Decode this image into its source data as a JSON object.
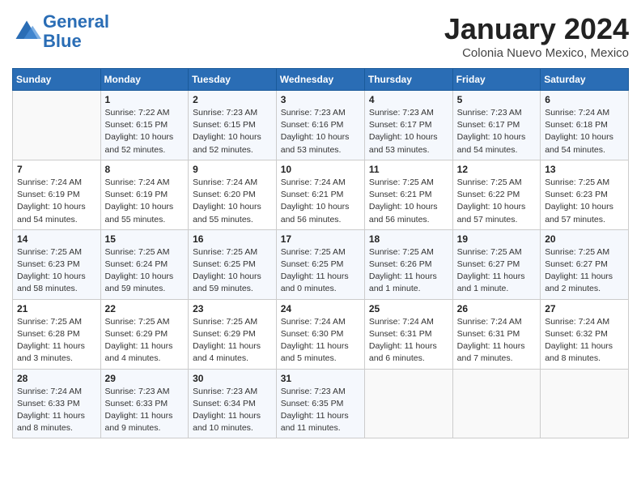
{
  "header": {
    "logo_line1": "General",
    "logo_line2": "Blue",
    "month_title": "January 2024",
    "subtitle": "Colonia Nuevo Mexico, Mexico"
  },
  "days_of_week": [
    "Sunday",
    "Monday",
    "Tuesday",
    "Wednesday",
    "Thursday",
    "Friday",
    "Saturday"
  ],
  "weeks": [
    [
      {
        "day": "",
        "sunrise": "",
        "sunset": "",
        "daylight": ""
      },
      {
        "day": "1",
        "sunrise": "Sunrise: 7:22 AM",
        "sunset": "Sunset: 6:15 PM",
        "daylight": "Daylight: 10 hours and 52 minutes."
      },
      {
        "day": "2",
        "sunrise": "Sunrise: 7:23 AM",
        "sunset": "Sunset: 6:15 PM",
        "daylight": "Daylight: 10 hours and 52 minutes."
      },
      {
        "day": "3",
        "sunrise": "Sunrise: 7:23 AM",
        "sunset": "Sunset: 6:16 PM",
        "daylight": "Daylight: 10 hours and 53 minutes."
      },
      {
        "day": "4",
        "sunrise": "Sunrise: 7:23 AM",
        "sunset": "Sunset: 6:17 PM",
        "daylight": "Daylight: 10 hours and 53 minutes."
      },
      {
        "day": "5",
        "sunrise": "Sunrise: 7:23 AM",
        "sunset": "Sunset: 6:17 PM",
        "daylight": "Daylight: 10 hours and 54 minutes."
      },
      {
        "day": "6",
        "sunrise": "Sunrise: 7:24 AM",
        "sunset": "Sunset: 6:18 PM",
        "daylight": "Daylight: 10 hours and 54 minutes."
      }
    ],
    [
      {
        "day": "7",
        "sunrise": "Sunrise: 7:24 AM",
        "sunset": "Sunset: 6:19 PM",
        "daylight": "Daylight: 10 hours and 54 minutes."
      },
      {
        "day": "8",
        "sunrise": "Sunrise: 7:24 AM",
        "sunset": "Sunset: 6:19 PM",
        "daylight": "Daylight: 10 hours and 55 minutes."
      },
      {
        "day": "9",
        "sunrise": "Sunrise: 7:24 AM",
        "sunset": "Sunset: 6:20 PM",
        "daylight": "Daylight: 10 hours and 55 minutes."
      },
      {
        "day": "10",
        "sunrise": "Sunrise: 7:24 AM",
        "sunset": "Sunset: 6:21 PM",
        "daylight": "Daylight: 10 hours and 56 minutes."
      },
      {
        "day": "11",
        "sunrise": "Sunrise: 7:25 AM",
        "sunset": "Sunset: 6:21 PM",
        "daylight": "Daylight: 10 hours and 56 minutes."
      },
      {
        "day": "12",
        "sunrise": "Sunrise: 7:25 AM",
        "sunset": "Sunset: 6:22 PM",
        "daylight": "Daylight: 10 hours and 57 minutes."
      },
      {
        "day": "13",
        "sunrise": "Sunrise: 7:25 AM",
        "sunset": "Sunset: 6:23 PM",
        "daylight": "Daylight: 10 hours and 57 minutes."
      }
    ],
    [
      {
        "day": "14",
        "sunrise": "Sunrise: 7:25 AM",
        "sunset": "Sunset: 6:23 PM",
        "daylight": "Daylight: 10 hours and 58 minutes."
      },
      {
        "day": "15",
        "sunrise": "Sunrise: 7:25 AM",
        "sunset": "Sunset: 6:24 PM",
        "daylight": "Daylight: 10 hours and 59 minutes."
      },
      {
        "day": "16",
        "sunrise": "Sunrise: 7:25 AM",
        "sunset": "Sunset: 6:25 PM",
        "daylight": "Daylight: 10 hours and 59 minutes."
      },
      {
        "day": "17",
        "sunrise": "Sunrise: 7:25 AM",
        "sunset": "Sunset: 6:25 PM",
        "daylight": "Daylight: 11 hours and 0 minutes."
      },
      {
        "day": "18",
        "sunrise": "Sunrise: 7:25 AM",
        "sunset": "Sunset: 6:26 PM",
        "daylight": "Daylight: 11 hours and 1 minute."
      },
      {
        "day": "19",
        "sunrise": "Sunrise: 7:25 AM",
        "sunset": "Sunset: 6:27 PM",
        "daylight": "Daylight: 11 hours and 1 minute."
      },
      {
        "day": "20",
        "sunrise": "Sunrise: 7:25 AM",
        "sunset": "Sunset: 6:27 PM",
        "daylight": "Daylight: 11 hours and 2 minutes."
      }
    ],
    [
      {
        "day": "21",
        "sunrise": "Sunrise: 7:25 AM",
        "sunset": "Sunset: 6:28 PM",
        "daylight": "Daylight: 11 hours and 3 minutes."
      },
      {
        "day": "22",
        "sunrise": "Sunrise: 7:25 AM",
        "sunset": "Sunset: 6:29 PM",
        "daylight": "Daylight: 11 hours and 4 minutes."
      },
      {
        "day": "23",
        "sunrise": "Sunrise: 7:25 AM",
        "sunset": "Sunset: 6:29 PM",
        "daylight": "Daylight: 11 hours and 4 minutes."
      },
      {
        "day": "24",
        "sunrise": "Sunrise: 7:24 AM",
        "sunset": "Sunset: 6:30 PM",
        "daylight": "Daylight: 11 hours and 5 minutes."
      },
      {
        "day": "25",
        "sunrise": "Sunrise: 7:24 AM",
        "sunset": "Sunset: 6:31 PM",
        "daylight": "Daylight: 11 hours and 6 minutes."
      },
      {
        "day": "26",
        "sunrise": "Sunrise: 7:24 AM",
        "sunset": "Sunset: 6:31 PM",
        "daylight": "Daylight: 11 hours and 7 minutes."
      },
      {
        "day": "27",
        "sunrise": "Sunrise: 7:24 AM",
        "sunset": "Sunset: 6:32 PM",
        "daylight": "Daylight: 11 hours and 8 minutes."
      }
    ],
    [
      {
        "day": "28",
        "sunrise": "Sunrise: 7:24 AM",
        "sunset": "Sunset: 6:33 PM",
        "daylight": "Daylight: 11 hours and 8 minutes."
      },
      {
        "day": "29",
        "sunrise": "Sunrise: 7:23 AM",
        "sunset": "Sunset: 6:33 PM",
        "daylight": "Daylight: 11 hours and 9 minutes."
      },
      {
        "day": "30",
        "sunrise": "Sunrise: 7:23 AM",
        "sunset": "Sunset: 6:34 PM",
        "daylight": "Daylight: 11 hours and 10 minutes."
      },
      {
        "day": "31",
        "sunrise": "Sunrise: 7:23 AM",
        "sunset": "Sunset: 6:35 PM",
        "daylight": "Daylight: 11 hours and 11 minutes."
      },
      {
        "day": "",
        "sunrise": "",
        "sunset": "",
        "daylight": ""
      },
      {
        "day": "",
        "sunrise": "",
        "sunset": "",
        "daylight": ""
      },
      {
        "day": "",
        "sunrise": "",
        "sunset": "",
        "daylight": ""
      }
    ]
  ]
}
